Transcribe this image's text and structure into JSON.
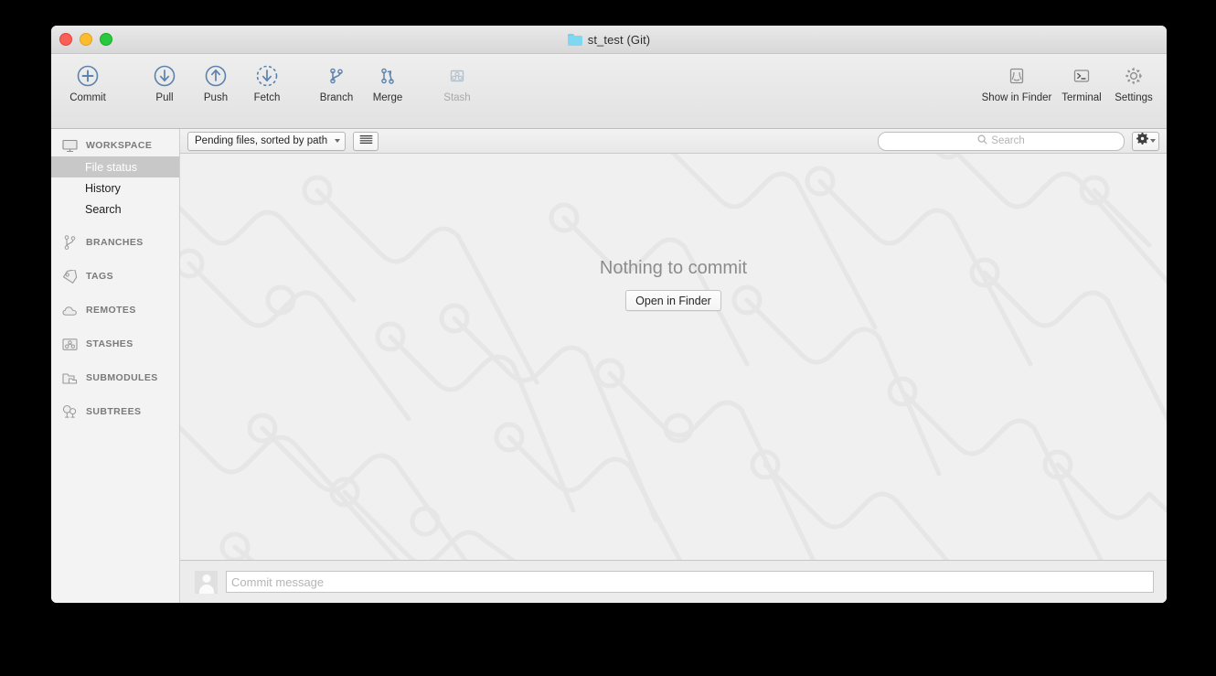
{
  "window": {
    "title": "st_test (Git)",
    "title_icon": "folder-icon",
    "traffic_lights": [
      {
        "name": "close",
        "color": "#fc5f57"
      },
      {
        "name": "minimize",
        "color": "#fdbc2e"
      },
      {
        "name": "maximize",
        "color": "#29c83f"
      }
    ]
  },
  "toolbar": {
    "left_items": [
      {
        "label": "Commit",
        "icon": "commit-plus-icon",
        "enabled": true
      },
      {
        "label": "Pull",
        "icon": "pull-down-arrow-icon",
        "enabled": true
      },
      {
        "label": "Push",
        "icon": "push-up-arrow-icon",
        "enabled": true
      },
      {
        "label": "Fetch",
        "icon": "fetch-dashed-arrow-icon",
        "enabled": true
      },
      {
        "label": "Branch",
        "icon": "branch-icon",
        "enabled": true
      },
      {
        "label": "Merge",
        "icon": "merge-icon",
        "enabled": true
      },
      {
        "label": "Stash",
        "icon": "stash-icon",
        "enabled": false
      }
    ],
    "right_items": [
      {
        "label": "Show in Finder",
        "icon": "finder-icon",
        "enabled": true
      },
      {
        "label": "Terminal",
        "icon": "terminal-icon",
        "enabled": true
      },
      {
        "label": "Settings",
        "icon": "gear-icon",
        "enabled": true
      }
    ],
    "accent_color": "#5b82ad",
    "disabled_color": "#a9a9a9"
  },
  "sidebar": {
    "sections": [
      {
        "label": "WORKSPACE",
        "icon": "monitor-icon",
        "children": [
          {
            "label": "File status",
            "selected": true
          },
          {
            "label": "History",
            "selected": false
          },
          {
            "label": "Search",
            "selected": false
          }
        ]
      },
      {
        "label": "BRANCHES",
        "icon": "branch-icon",
        "children": []
      },
      {
        "label": "TAGS",
        "icon": "tag-icon",
        "children": []
      },
      {
        "label": "REMOTES",
        "icon": "cloud-icon",
        "children": []
      },
      {
        "label": "STASHES",
        "icon": "stash-icon",
        "children": []
      },
      {
        "label": "SUBMODULES",
        "icon": "submodule-icon",
        "children": []
      },
      {
        "label": "SUBTREES",
        "icon": "subtree-icon",
        "children": []
      }
    ],
    "selection_color": "#c8c8c8"
  },
  "filterbar": {
    "sort_popup_label": "Pending files, sorted by path",
    "sort_popup_icon": "chevron-down-icon",
    "view_mode_button_icon": "list-view-icon",
    "search_placeholder": "Search",
    "search_value": "",
    "search_icon": "search-icon",
    "gear_button_icon": "gear-icon",
    "gear_button_chevron": "chevron-down-icon"
  },
  "main": {
    "empty_title": "Nothing to commit",
    "open_in_finder_label": "Open in Finder",
    "watermark": "circuit-graph-pattern"
  },
  "commitbar": {
    "avatar_icon": "user-avatar",
    "commit_message_placeholder": "Commit message",
    "commit_message_value": ""
  }
}
